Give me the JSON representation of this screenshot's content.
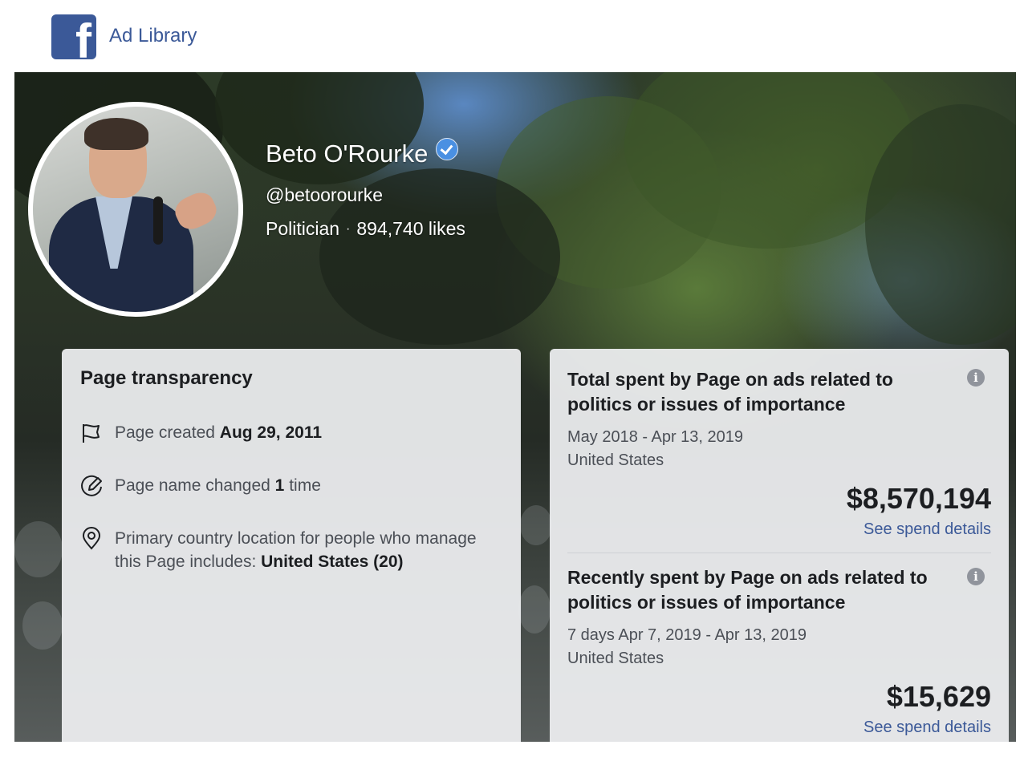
{
  "header": {
    "logo_letter": "f",
    "product_name": "Ad Library"
  },
  "profile": {
    "name": "Beto O'Rourke",
    "handle": "@betoorourke",
    "category": "Politician",
    "separator": "·",
    "likes": "894,740 likes",
    "verified": true
  },
  "transparency": {
    "title": "Page transparency",
    "created_prefix": "Page created",
    "created_date": "Aug 29, 2011",
    "name_changed_prefix": "Page name changed",
    "name_changed_count": "1",
    "name_changed_suffix": "time",
    "location_prefix": "Primary country location for people who manage this Page includes:",
    "location_value": "United States (20)",
    "icons": [
      "flag-icon",
      "edit-circle-icon",
      "location-pin-icon"
    ]
  },
  "spending": {
    "total": {
      "title": "Total spent by Page on ads related to politics or issues of importance",
      "range": "May 2018 - Apr 13, 2019",
      "country": "United States",
      "amount": "$8,570,194",
      "details_link": "See spend details"
    },
    "recent": {
      "title": "Recently spent by Page on ads related to politics or issues of importance",
      "range": "7 days Apr 7, 2019 - Apr 13, 2019",
      "country": "United States",
      "amount": "$15,629",
      "details_link": "See spend details"
    },
    "info_icon": "i"
  },
  "colors": {
    "facebook_blue": "#3b5998",
    "verified_blue": "#4a90e2",
    "card_bg": "#eff0f2"
  }
}
